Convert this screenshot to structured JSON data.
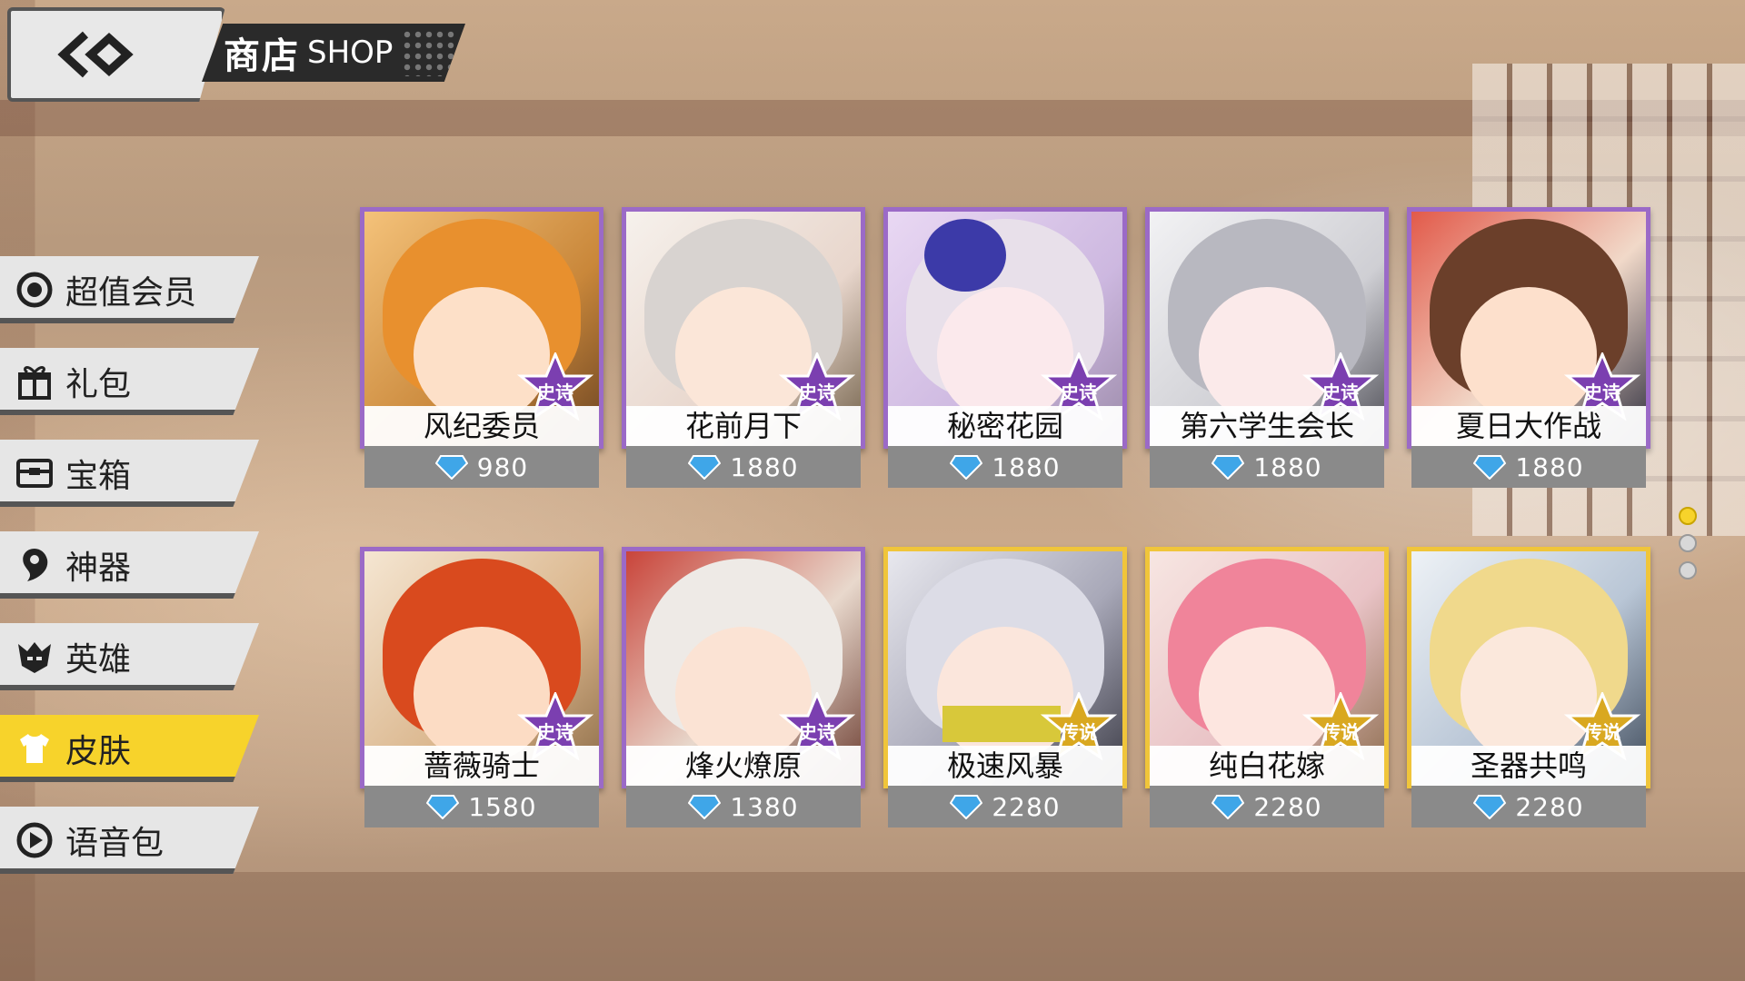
{
  "header": {
    "title_cn": "商店",
    "title_en": "SHOP",
    "back_icon": "back-arrow-icon"
  },
  "sidebar": {
    "items": [
      {
        "label": "超值会员",
        "icon": "vip-icon"
      },
      {
        "label": "礼包",
        "icon": "gift-icon"
      },
      {
        "label": "宝箱",
        "icon": "chest-icon"
      },
      {
        "label": "神器",
        "icon": "artifact-icon"
      },
      {
        "label": "英雄",
        "icon": "hero-icon"
      },
      {
        "label": "皮肤",
        "icon": "skin-icon",
        "active": true
      },
      {
        "label": "语音包",
        "icon": "voice-icon"
      }
    ]
  },
  "cards": [
    {
      "name": "风纪委员",
      "price": "980",
      "rarity": "史诗",
      "tier": "epic"
    },
    {
      "name": "花前月下",
      "price": "1880",
      "rarity": "史诗",
      "tier": "epic"
    },
    {
      "name": "秘密花园",
      "price": "1880",
      "rarity": "史诗",
      "tier": "epic"
    },
    {
      "name": "第六学生会长",
      "price": "1880",
      "rarity": "史诗",
      "tier": "epic"
    },
    {
      "name": "夏日大作战",
      "price": "1880",
      "rarity": "史诗",
      "tier": "epic"
    },
    {
      "name": "蔷薇骑士",
      "price": "1580",
      "rarity": "史诗",
      "tier": "epic"
    },
    {
      "name": "烽火燎原",
      "price": "1380",
      "rarity": "史诗",
      "tier": "epic"
    },
    {
      "name": "极速风暴",
      "price": "2280",
      "rarity": "传说",
      "tier": "legend"
    },
    {
      "name": "纯白花嫁",
      "price": "2280",
      "rarity": "传说",
      "tier": "legend"
    },
    {
      "name": "圣器共鸣",
      "price": "2280",
      "rarity": "传说",
      "tier": "legend"
    }
  ],
  "pager": {
    "pages": 3,
    "current": 1
  },
  "colors": {
    "accent": "#f7d32b",
    "epic": "#9b6ac7",
    "legend": "#f0c53a",
    "gem": "#3fa6e8"
  }
}
